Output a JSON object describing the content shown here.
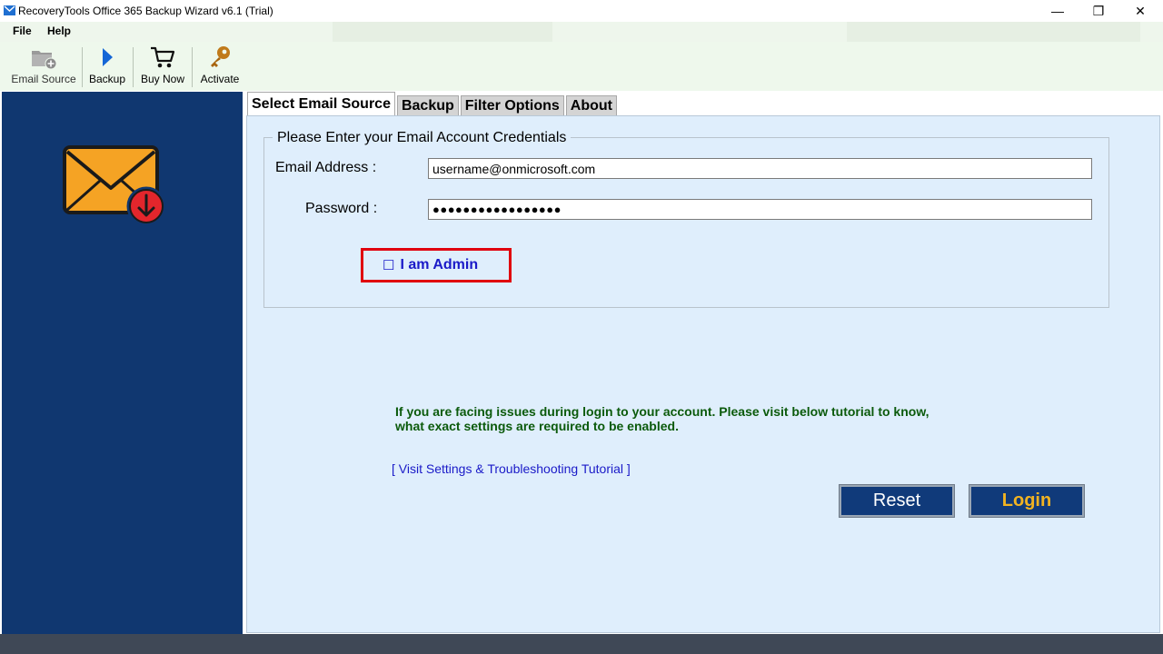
{
  "window": {
    "title": "RecoveryTools Office 365 Backup Wizard v6.1 (Trial)",
    "minimize": "—",
    "maximize": "❐",
    "close": "✕"
  },
  "menu": {
    "items": [
      "File",
      "Help"
    ]
  },
  "toolbar": {
    "email_source": "Email Source",
    "backup": "Backup",
    "buy_now": "Buy Now",
    "activate": "Activate"
  },
  "tabs": [
    "Select Email Source",
    "Backup",
    "Filter Options",
    "About"
  ],
  "credentials": {
    "legend": "Please Enter your Email Account Credentials",
    "email_label": "Email Address :",
    "email_value": "username@onmicrosoft.com",
    "password_label": "Password :",
    "password_value": "●●●●●●●●●●●●●●●●●",
    "admin_label": "I am Admin",
    "admin_checked": false
  },
  "help": {
    "line1": "If you are facing issues during login to your account. Please visit below tutorial to know,",
    "line2": "what exact settings are required to be enabled.",
    "link": "[ Visit Settings & Troubleshooting Tutorial ]"
  },
  "buttons": {
    "reset": "Reset",
    "login": "Login"
  },
  "colors": {
    "left_panel": "#103770",
    "content_bg": "#dfeefc",
    "button_bg": "#103a7a",
    "login_text": "#f2b321",
    "highlight": "#e0000e",
    "help_text": "#0b5a0b",
    "link": "#1a1ac8"
  },
  "icons": {
    "app": "app-logo-icon",
    "email_source": "folder-add-icon",
    "backup": "play-arrow-icon",
    "buy_now": "cart-icon",
    "activate": "key-icon",
    "hero": "envelope-download-icon"
  }
}
